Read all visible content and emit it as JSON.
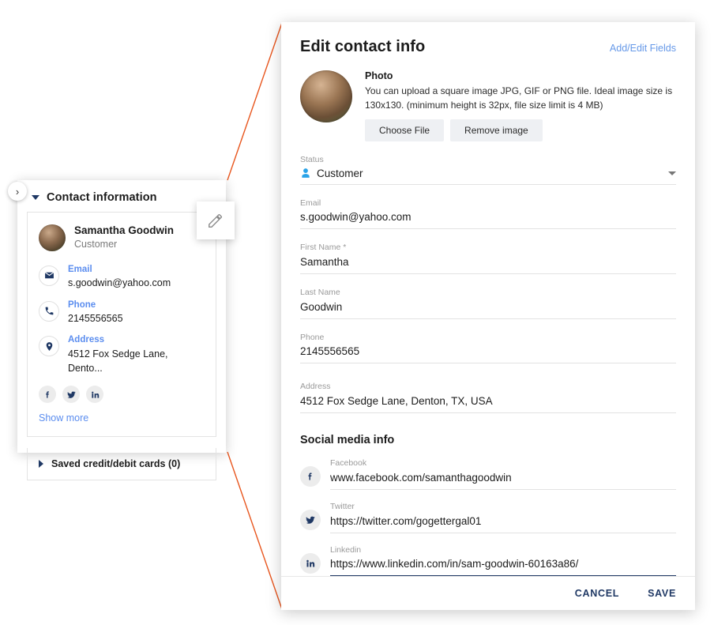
{
  "left_panel": {
    "expand_handle": "›",
    "section_title": "Contact information",
    "contact": {
      "name": "Samantha Goodwin",
      "role": "Customer",
      "details": [
        {
          "label": "Email",
          "value": "s.goodwin@yahoo.com",
          "icon": "envelope-icon"
        },
        {
          "label": "Phone",
          "value": "2145556565",
          "icon": "phone-icon"
        },
        {
          "label": "Address",
          "value": "4512 Fox Sedge Lane, Dento...",
          "icon": "location-pin-icon"
        }
      ],
      "social_icons": [
        "facebook-icon",
        "twitter-icon",
        "linkedin-icon"
      ],
      "show_more": "Show more"
    },
    "saved_cards": "Saved credit/debit cards (0)"
  },
  "dialog": {
    "title": "Edit contact info",
    "add_edit_fields": "Add/Edit Fields",
    "photo": {
      "title": "Photo",
      "description": "You can upload a square image JPG, GIF or PNG file. Ideal image size is 130x130. (minimum height is 32px, file size limit is 4 MB)",
      "choose_file": "Choose File",
      "remove_image": "Remove image"
    },
    "fields": {
      "status_label": "Status",
      "status_value": "Customer",
      "email_label": "Email",
      "email_value": "s.goodwin@yahoo.com",
      "first_name_label": "First Name *",
      "first_name_value": "Samantha",
      "last_name_label": "Last Name",
      "last_name_value": "Goodwin",
      "phone_label": "Phone",
      "phone_value": "2145556565",
      "address_label": "Address",
      "address_value": "4512 Fox Sedge Lane, Denton, TX, USA"
    },
    "social": {
      "section_title": "Social media info",
      "facebook_label": "Facebook",
      "facebook_value": "www.facebook.com/samanthagoodwin",
      "twitter_label": "Twitter",
      "twitter_value": "https://twitter.com/gogettergal01",
      "linkedin_label": "Linkedin",
      "linkedin_value": "https://www.linkedin.com/in/sam-goodwin-60163a86/"
    },
    "footer": {
      "cancel": "CANCEL",
      "save": "SAVE"
    }
  },
  "colors": {
    "accent_link": "#5b8def",
    "dialog_link": "#6699e8",
    "navy": "#1f3864",
    "connector": "#e8561e"
  }
}
